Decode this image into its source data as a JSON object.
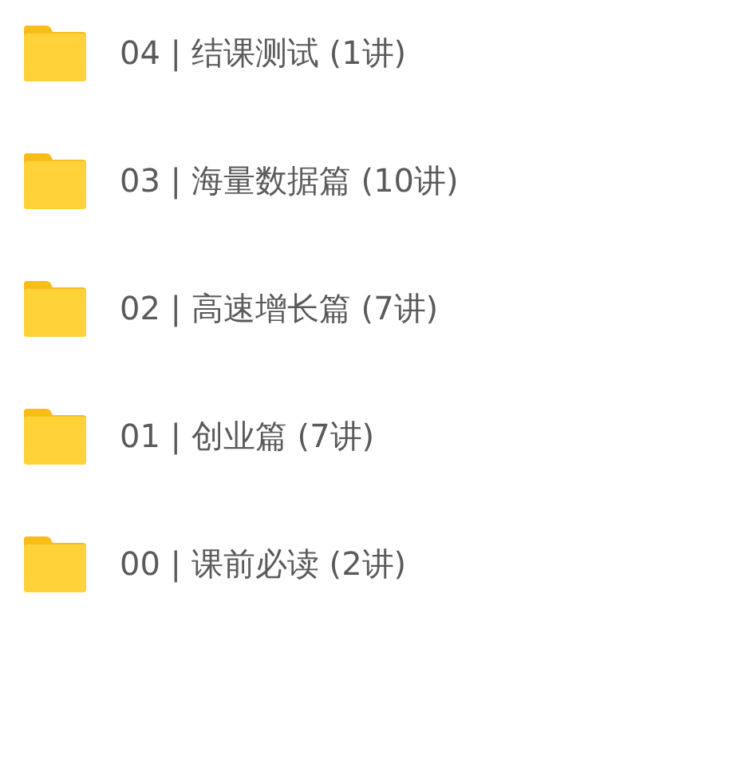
{
  "folders": [
    {
      "name": "04 | 结课测试 (1讲)"
    },
    {
      "name": "03 | 海量数据篇 (10讲)"
    },
    {
      "name": "02 | 高速增长篇 (7讲)"
    },
    {
      "name": "01 | 创业篇 (7讲)"
    },
    {
      "name": "00 | 课前必读 (2讲)"
    }
  ]
}
